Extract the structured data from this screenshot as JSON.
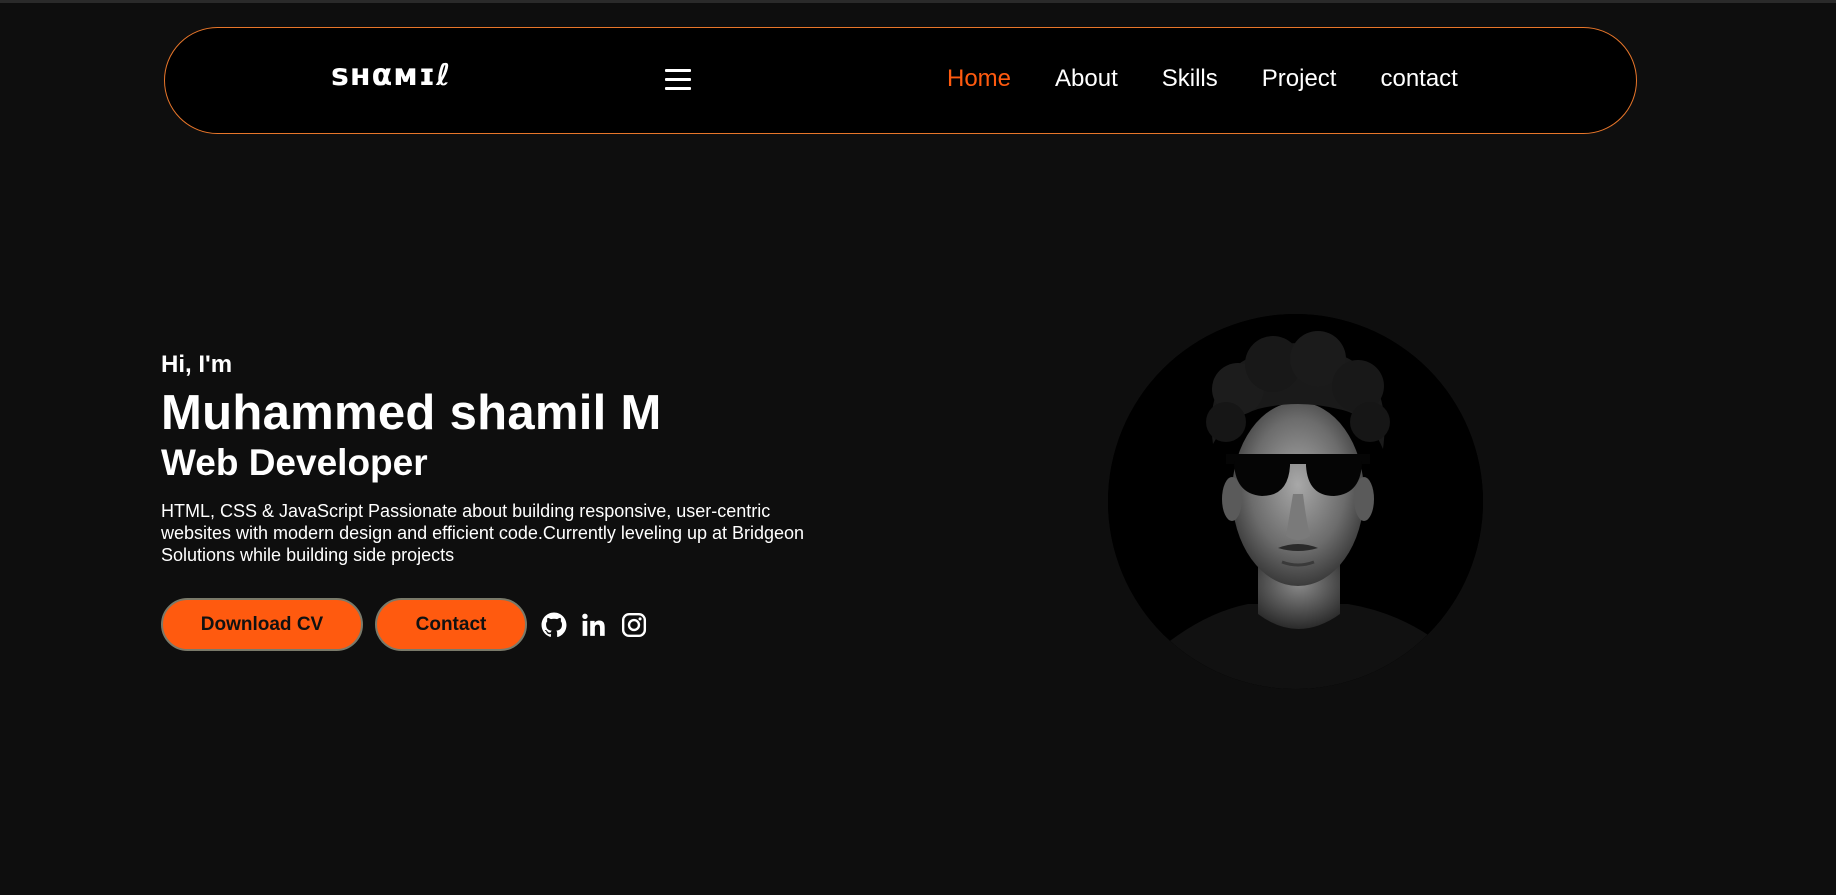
{
  "brand": {
    "logo_text": "sʜαмɪℓ"
  },
  "nav": {
    "menu_icon": "hamburger-icon",
    "links": [
      {
        "label": "Home",
        "active": true
      },
      {
        "label": "About",
        "active": false
      },
      {
        "label": "Skills",
        "active": false
      },
      {
        "label": "Project",
        "active": false
      },
      {
        "label": "contact",
        "active": false
      }
    ]
  },
  "hero": {
    "greeting": "Hi, I'm",
    "name": "Muhammed shamil M",
    "role": "Web Developer",
    "description": "HTML, CSS & JavaScript Passionate about building responsive, user-centric websites with modern design and efficient code.Currently leveling up at Bridgeon Solutions while building side projects",
    "buttons": {
      "download_cv": "Download CV",
      "contact": "Contact"
    },
    "socials": [
      "github-icon",
      "linkedin-icon",
      "instagram-icon"
    ]
  },
  "colors": {
    "background": "#0e0e0e",
    "navbar_background": "#000000",
    "navbar_border": "#e8762a",
    "accent": "#ff5a0f",
    "text": "#ffffff"
  }
}
